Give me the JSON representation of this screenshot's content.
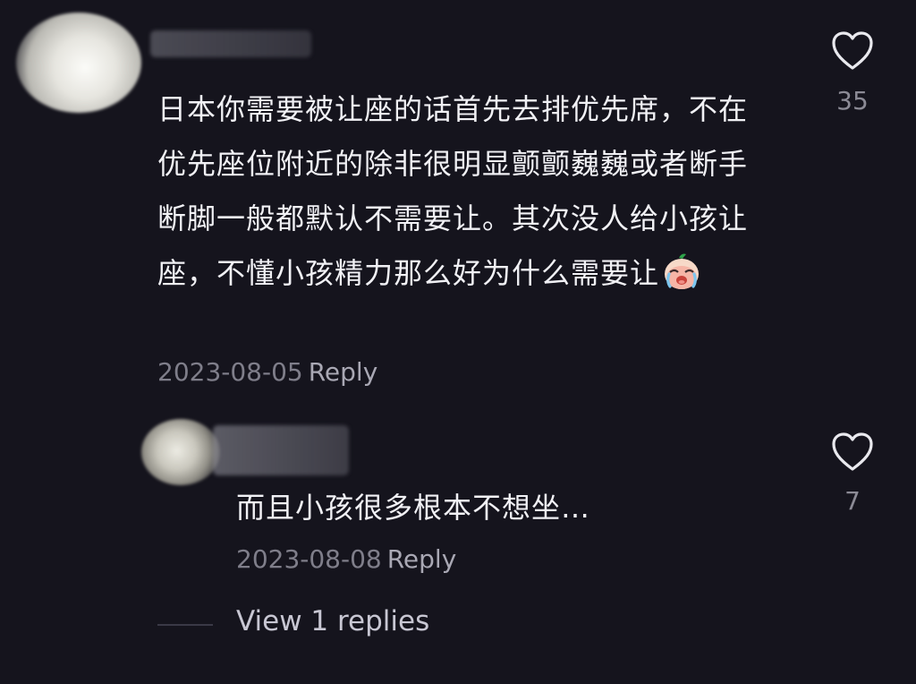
{
  "comment": {
    "text": "日本你需要被让座的话首先去排优先席，不在优先座位附近的除非很明显颤颤巍巍或者断手断脚一般都默认不需要让。其次没人给小孩让座，不懂小孩精力那么好为什么需要让",
    "date": "2023-08-05",
    "reply_label": "Reply",
    "like_count": "35",
    "emoji": "crying-face-emoji"
  },
  "reply_comment": {
    "text": "而且小孩很多根本不想坐…",
    "date": "2023-08-08",
    "reply_label": "Reply",
    "like_count": "7"
  },
  "view_replies": {
    "label": "View 1 replies"
  },
  "colors": {
    "background": "#15141d",
    "text": "#f1f1f5",
    "meta": "#7f7e8a"
  }
}
